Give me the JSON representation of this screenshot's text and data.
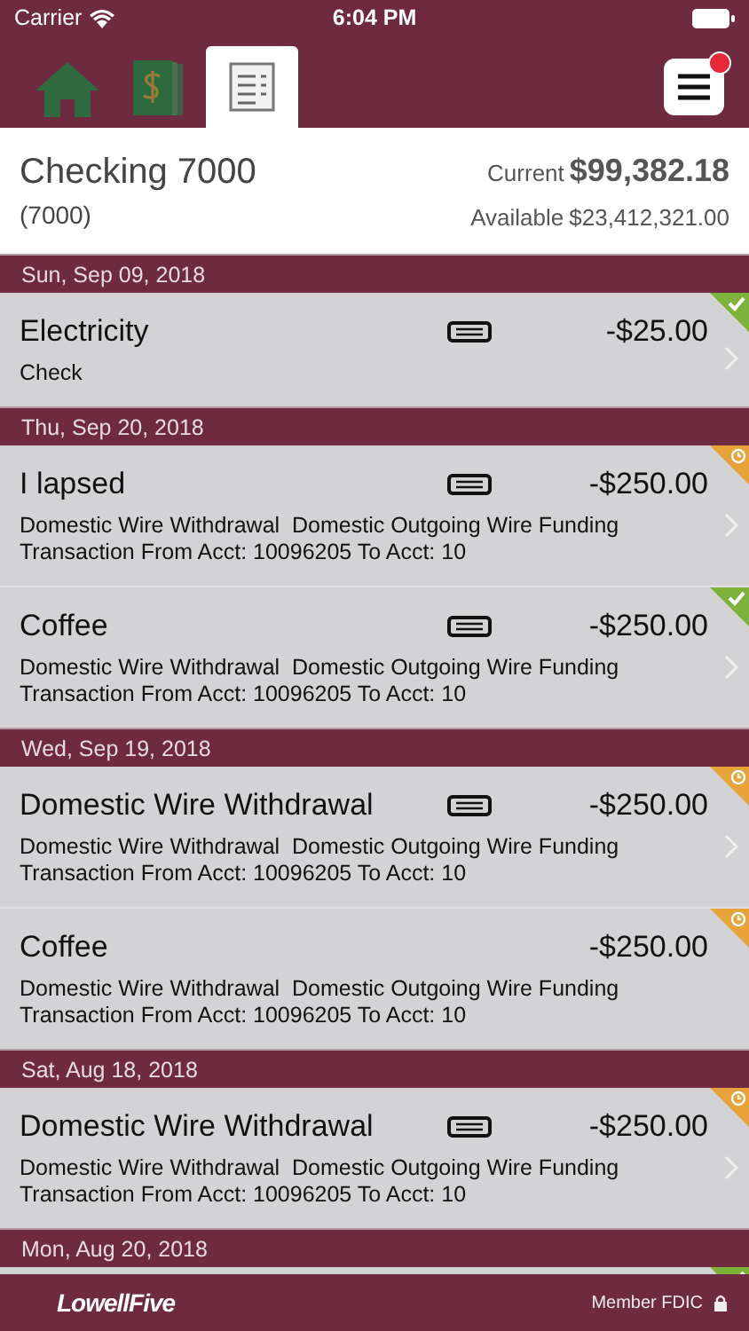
{
  "status_bar": {
    "carrier": "Carrier",
    "time": "6:04 PM"
  },
  "tabs": [
    {
      "kind": "home",
      "selected": false
    },
    {
      "kind": "money",
      "selected": false
    },
    {
      "kind": "statement",
      "selected": true
    }
  ],
  "menu": {
    "notification": true
  },
  "account": {
    "name": "Checking 7000",
    "number": "(7000)",
    "current_label": "Current",
    "current_amount": "$99,382.18",
    "available_label": "Available",
    "available_amount": "$23,412,321.00"
  },
  "groups": [
    {
      "date": "Sun, Sep 09, 2018",
      "transactions": [
        {
          "title": "Electricity",
          "card": true,
          "amount": "-$25.00",
          "lines": [
            "Check"
          ],
          "cleared": true,
          "chevron": true
        }
      ]
    },
    {
      "date": "Thu, Sep 20, 2018",
      "transactions": [
        {
          "title": "I lapsed",
          "card": true,
          "amount": "-$250.00",
          "lines": [
            "Domestic Wire Withdrawal  Domestic Outgoing Wire Funding",
            "Transaction From Acct: 10096205 To Acct: 10"
          ],
          "cleared": false,
          "chevron": true
        },
        {
          "title": "Coffee",
          "card": true,
          "amount": "-$250.00",
          "lines": [
            "Domestic Wire Withdrawal  Domestic Outgoing Wire Funding",
            "Transaction From Acct: 10096205 To Acct: 10"
          ],
          "cleared": true,
          "chevron": true
        }
      ]
    },
    {
      "date": "Wed, Sep 19, 2018",
      "transactions": [
        {
          "title": "Domestic Wire Withdrawal",
          "card": true,
          "amount": "-$250.00",
          "lines": [
            "Domestic Wire Withdrawal  Domestic Outgoing Wire Funding",
            "Transaction From Acct: 10096205 To Acct: 10"
          ],
          "cleared": false,
          "chevron": true
        },
        {
          "title": "Coffee",
          "card": false,
          "amount": "-$250.00",
          "lines": [
            "Domestic Wire Withdrawal  Domestic Outgoing Wire Funding",
            "Transaction From Acct: 10096205 To Acct: 10"
          ],
          "cleared": false,
          "chevron": false
        }
      ]
    },
    {
      "date": "Sat, Aug 18, 2018",
      "transactions": [
        {
          "title": "Domestic Wire Withdrawal",
          "card": true,
          "amount": "-$250.00",
          "lines": [
            "Domestic Wire Withdrawal  Domestic Outgoing Wire Funding",
            "Transaction From Acct: 10096205 To Acct: 10"
          ],
          "cleared": false,
          "chevron": true
        }
      ]
    },
    {
      "date": "Mon, Aug 20, 2018",
      "transactions": [
        {
          "cleared": true
        }
      ]
    }
  ],
  "footer": {
    "logo": "LowellFive",
    "member": "Member FDIC"
  }
}
